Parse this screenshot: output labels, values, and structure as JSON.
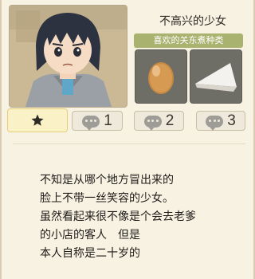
{
  "character": {
    "name": "不高兴的少女",
    "portrait_icon": "sulky-girl-portrait"
  },
  "favorites": {
    "header": "喜欢的关东煮种类",
    "items": [
      {
        "icon": "egg-icon"
      },
      {
        "icon": "hanpen-icon"
      }
    ]
  },
  "tabs": [
    {
      "icon": "star-icon"
    },
    {
      "icon": "chat-bubble-icon",
      "label": "1"
    },
    {
      "icon": "chat-bubble-icon",
      "label": "2"
    },
    {
      "icon": "chat-bubble-icon",
      "label": "3"
    }
  ],
  "description": {
    "lines": [
      "不知是从哪个地方冒出来的",
      "脸上不带一丝笑容的少女。",
      "虽然看起来很不像是个会去老爹",
      "的小店的客人　但是",
      "本人自称是二十岁的"
    ]
  },
  "colors": {
    "background": "#f8f2e3",
    "fav_header": "#a9b26f",
    "selected_tab": "#fbf1c7"
  }
}
